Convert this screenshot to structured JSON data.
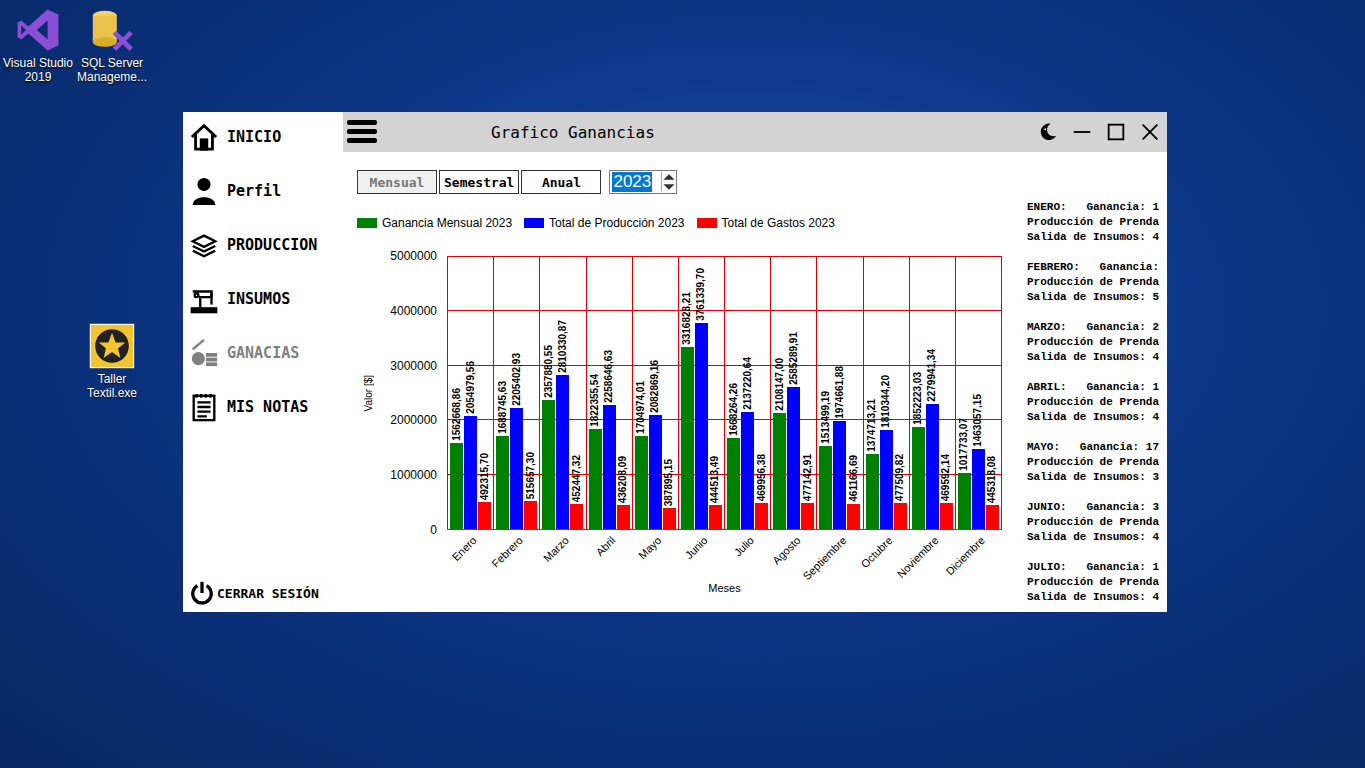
{
  "desktop": {
    "icons": [
      {
        "label": "Visual Studio 2019",
        "kind": "vs"
      },
      {
        "label": "SQL Server Manageme...",
        "kind": "sql"
      },
      {
        "label": "Taller Textil.exe",
        "kind": "app"
      }
    ]
  },
  "window": {
    "title": "Grafico Ganancias"
  },
  "sidebar": {
    "items": [
      {
        "label": "INICIO",
        "icon": "home",
        "selected": false
      },
      {
        "label": "Perfil",
        "icon": "user",
        "selected": false
      },
      {
        "label": "PRODUCCION",
        "icon": "stack",
        "selected": false
      },
      {
        "label": "INSUMOS",
        "icon": "sew",
        "selected": false
      },
      {
        "label": "GANACIAS",
        "icon": "coins",
        "selected": true
      },
      {
        "label": "MIS NOTAS",
        "icon": "notes",
        "selected": false
      }
    ],
    "logout": "CERRAR SESIÓN"
  },
  "period_buttons": [
    {
      "label": "Mensual",
      "selected": true
    },
    {
      "label": "Semestral",
      "selected": false
    },
    {
      "label": "Anual",
      "selected": false
    }
  ],
  "year_input": {
    "value": "2023"
  },
  "chart": {
    "y_title": "Valor [$]",
    "x_title": "Meses",
    "max": 5000000,
    "y_ticks": [
      "5000000",
      "4000000",
      "3000000",
      "2000000",
      "1000000",
      "0"
    ],
    "categories": [
      "Enero",
      "Febrero",
      "Marzo",
      "Abril",
      "Mayo",
      "Junio",
      "Julio",
      "Agosto",
      "Septiembre",
      "Octubre",
      "Noviembre",
      "Diciembre"
    ],
    "series": [
      {
        "name": "Ganancia Mensual 2023",
        "color": "#008000",
        "values": [
          1562668.86,
          1688745.63,
          2357880.55,
          1822355.54,
          1704974.01,
          3316828.21,
          1668264.26,
          2108147.0,
          1513499.19,
          1374713.21,
          1852223.03,
          1017733.07
        ],
        "labels": [
          "1562668,86",
          "1688745,63",
          "2357880,55",
          "1822355,54",
          "1704974,01",
          "3316828,21",
          "1668264,26",
          "2108147,00",
          "1513499,19",
          "1374713,21",
          "1852223,03",
          "1017733,07"
        ]
      },
      {
        "name": "Total de Producción 2023",
        "color": "#0000ff",
        "values": [
          2054979.56,
          2205402.93,
          2810330.87,
          2258646.63,
          2082869.16,
          3761339.7,
          2137220.64,
          2585289.91,
          1974661.88,
          1810344.2,
          2279941.34,
          1463057.15
        ],
        "labels": [
          "2054979,56",
          "2205402,93",
          "2810330,87",
          "2258646,63",
          "2082869,16",
          "3761339,70",
          "2137220,64",
          "2585289,91",
          "1974661,88",
          "1810344,20",
          "2279941,34",
          "1463057,15"
        ]
      },
      {
        "name": "Total de Gastos 2023",
        "color": "#ff0000",
        "values": [
          492315.7,
          515657.3,
          452447.32,
          436208.09,
          387895.15,
          444513.49,
          469956.38,
          477142.91,
          461166.69,
          477509.82,
          469592.14,
          445318.08
        ],
        "labels": [
          "492315,70",
          "515657,30",
          "452447,32",
          "436208,09",
          "387895,15",
          "444513,49",
          "469956,38",
          "477142,91",
          "461166,69",
          "477509,82",
          "469592,14",
          "445318,08"
        ]
      }
    ]
  },
  "summary": [
    {
      "lines": [
        "ENERO:   Ganancia: 1",
        "Producción de Prenda",
        "Salida de Insumos: 4"
      ]
    },
    {
      "lines": [
        "FEBRERO:   Ganancia:",
        "Producción de Prenda",
        "Salida de Insumos: 5"
      ]
    },
    {
      "lines": [
        "MARZO:   Ganancia: 2",
        "Producción de Prenda",
        "Salida de Insumos: 4"
      ]
    },
    {
      "lines": [
        "ABRIL:   Ganancia: 1",
        "Producción de Prenda",
        "Salida de Insumos: 4"
      ]
    },
    {
      "lines": [
        "MAYO:   Ganancia: 17",
        "Producción de Prenda",
        "Salida de Insumos: 3"
      ]
    },
    {
      "lines": [
        "JUNIO:   Ganancia: 3",
        "Producción de Prenda",
        "Salida de Insumos: 4"
      ]
    },
    {
      "lines": [
        "JULIO:   Ganancia: 1",
        "Producción de Prenda",
        "Salida de Insumos: 4"
      ]
    }
  ]
}
